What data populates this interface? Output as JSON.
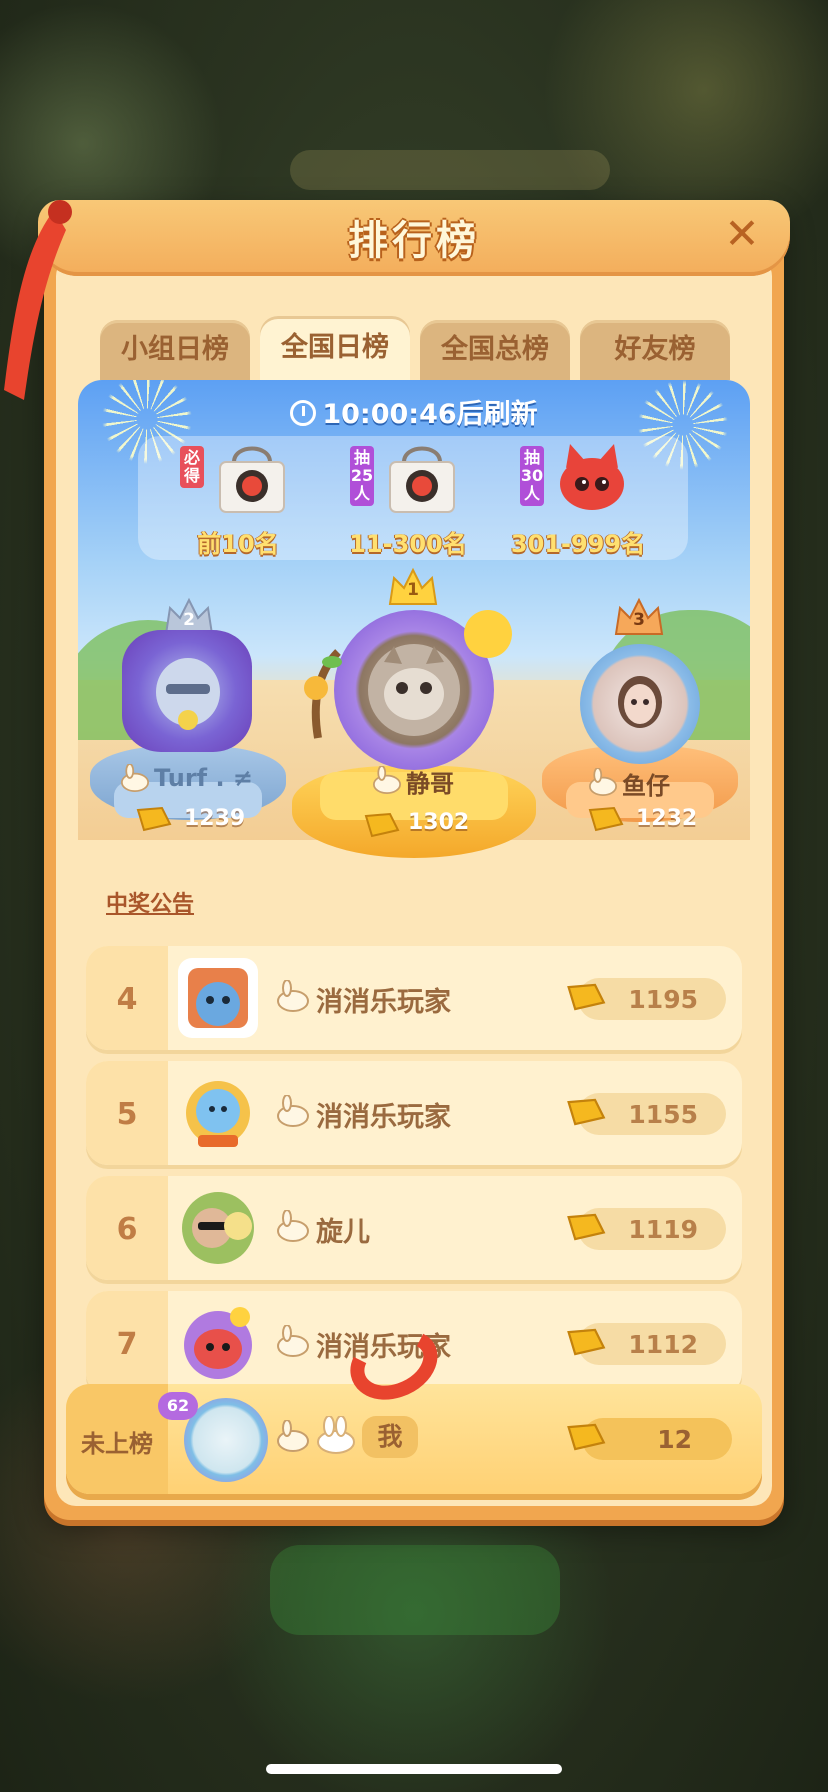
{
  "header": {
    "title": "排行榜",
    "close_icon": "close-icon"
  },
  "tabs": [
    {
      "label": "小组日榜",
      "active": false
    },
    {
      "label": "全国日榜",
      "active": true
    },
    {
      "label": "全国总榜",
      "active": false
    },
    {
      "label": "好友榜",
      "active": false
    }
  ],
  "timer": {
    "text": "10:00:46后刷新"
  },
  "rewards": [
    {
      "tag": "必得",
      "label": "前10名",
      "icon": "gift-bag-icon",
      "tag_color": "#e8505b"
    },
    {
      "tag": "抽25人",
      "label": "11-300名",
      "icon": "gift-bag-icon",
      "tag_color": "#b04fd8"
    },
    {
      "tag": "抽30人",
      "label": "301-999名",
      "icon": "red-pet-icon",
      "tag_color": "#b04fd8"
    }
  ],
  "podium": [
    {
      "rank": "1",
      "name": "静哥",
      "score": "1302"
    },
    {
      "rank": "2",
      "name": "Turf . ≠",
      "score": "1239"
    },
    {
      "rank": "3",
      "name": "鱼仔",
      "score": "1232"
    }
  ],
  "notice": "中奖公告",
  "list": [
    {
      "rank": "4",
      "name": "消消乐玩家",
      "score": "1195"
    },
    {
      "rank": "5",
      "name": "消消乐玩家",
      "score": "1155"
    },
    {
      "rank": "6",
      "name": "旋儿",
      "score": "1119"
    },
    {
      "rank": "7",
      "name": "消消乐玩家",
      "score": "1112"
    }
  ],
  "me": {
    "rank": "未上榜",
    "level": "62",
    "name": "我",
    "score": "12"
  },
  "colors": {
    "panel": "#f1a64f",
    "gold": "#f5b81f",
    "accent": "#9a6132"
  }
}
